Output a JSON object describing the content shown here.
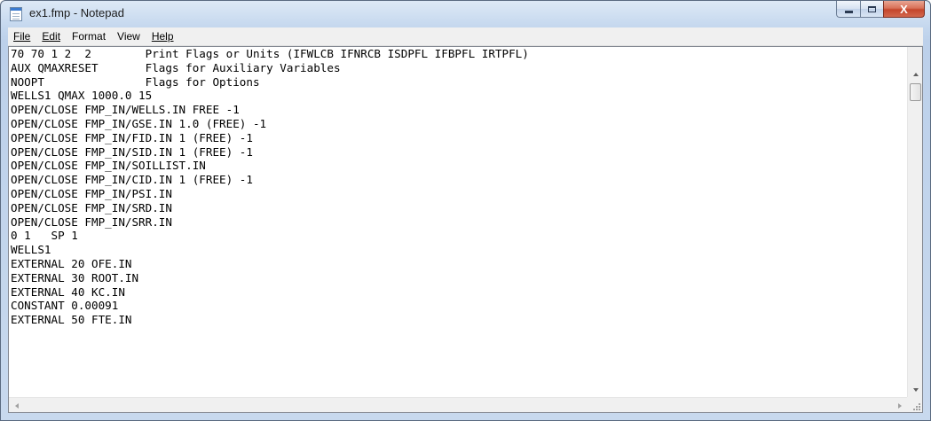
{
  "window": {
    "title": "ex1.fmp - Notepad",
    "close_glyph": "X"
  },
  "menu": [
    "File",
    "Edit",
    "Format",
    "View",
    "Help"
  ],
  "lines": [
    "70 70 1 2  2        Print Flags or Units (IFWLCB IFNRCB ISDPFL IFBPFL IRTPFL)",
    "AUX QMAXRESET       Flags for Auxiliary Variables",
    "NOOPT               Flags for Options",
    "WELLS1 QMAX 1000.0 15",
    "OPEN/CLOSE FMP_IN/WELLS.IN FREE -1",
    "OPEN/CLOSE FMP_IN/GSE.IN 1.0 (FREE) -1",
    "OPEN/CLOSE FMP_IN/FID.IN 1 (FREE) -1",
    "OPEN/CLOSE FMP_IN/SID.IN 1 (FREE) -1",
    "OPEN/CLOSE FMP_IN/SOILLIST.IN",
    "OPEN/CLOSE FMP_IN/CID.IN 1 (FREE) -1",
    "OPEN/CLOSE FMP_IN/PSI.IN",
    "OPEN/CLOSE FMP_IN/SRD.IN",
    "OPEN/CLOSE FMP_IN/SRR.IN",
    "0 1   SP 1",
    "WELLS1",
    "EXTERNAL 20 OFE.IN",
    "EXTERNAL 30 ROOT.IN",
    "EXTERNAL 40 KC.IN",
    "CONSTANT 0.00091",
    "EXTERNAL 50 FTE.IN"
  ]
}
